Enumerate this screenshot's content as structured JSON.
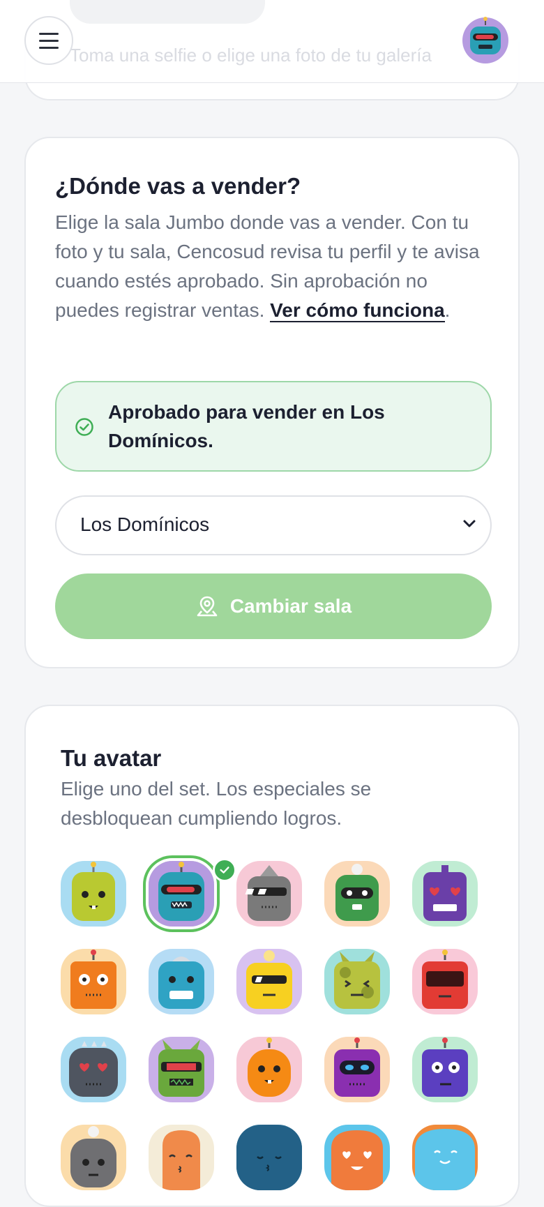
{
  "header": {
    "menu_label": "Menú",
    "ghost_text": "Toma una selfie o elige una foto de tu galería"
  },
  "sala": {
    "title": "¿Dónde vas a vender?",
    "description": "Elige la sala Jumbo donde vas a vender. Con tu foto y tu sala, Cencosud revisa tu perfil y te avisa cuando estés aprobado. Sin aprobación no puedes registrar ventas.",
    "link_label": "Ver cómo funciona",
    "approved_message": "Aprobado para vender en Los Domínicos.",
    "selected_sala": "Los Domínicos",
    "change_button": "Cambiar sala"
  },
  "avatar": {
    "title": "Tu avatar",
    "description": "Elige uno del set. Los especiales se desbloquean cumpliendo logros.",
    "selected_index": 1
  },
  "colors": {
    "accent_green": "#5cc15d",
    "button_green": "#a0d79b",
    "approved_bg": "#eaf7ee"
  }
}
